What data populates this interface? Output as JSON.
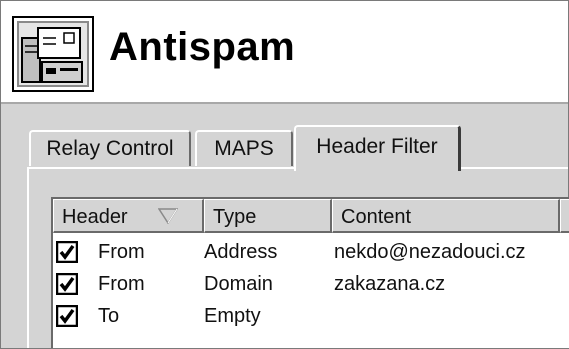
{
  "window": {
    "title": "Antispam",
    "icon": "mail-server-icon"
  },
  "tabs": [
    {
      "label": "Relay Control",
      "active": false
    },
    {
      "label": "MAPS",
      "active": false
    },
    {
      "label": "Header Filter",
      "active": true
    }
  ],
  "list": {
    "columns": [
      {
        "label": "Header",
        "sorted": "descending"
      },
      {
        "label": "Type"
      },
      {
        "label": "Content"
      },
      {
        "label": ""
      }
    ],
    "rows": [
      {
        "checked": true,
        "header": "From",
        "type": "Address",
        "content": "nekdo@nezadouci.cz"
      },
      {
        "checked": true,
        "header": "From",
        "type": "Domain",
        "content": "zakazana.cz"
      },
      {
        "checked": true,
        "header": "To",
        "type": "Empty",
        "content": ""
      }
    ]
  },
  "colors": {
    "face": "#d4d4d4",
    "highlight": "#ffffff",
    "shadow": "#6a6a6a",
    "text": "#111111"
  }
}
